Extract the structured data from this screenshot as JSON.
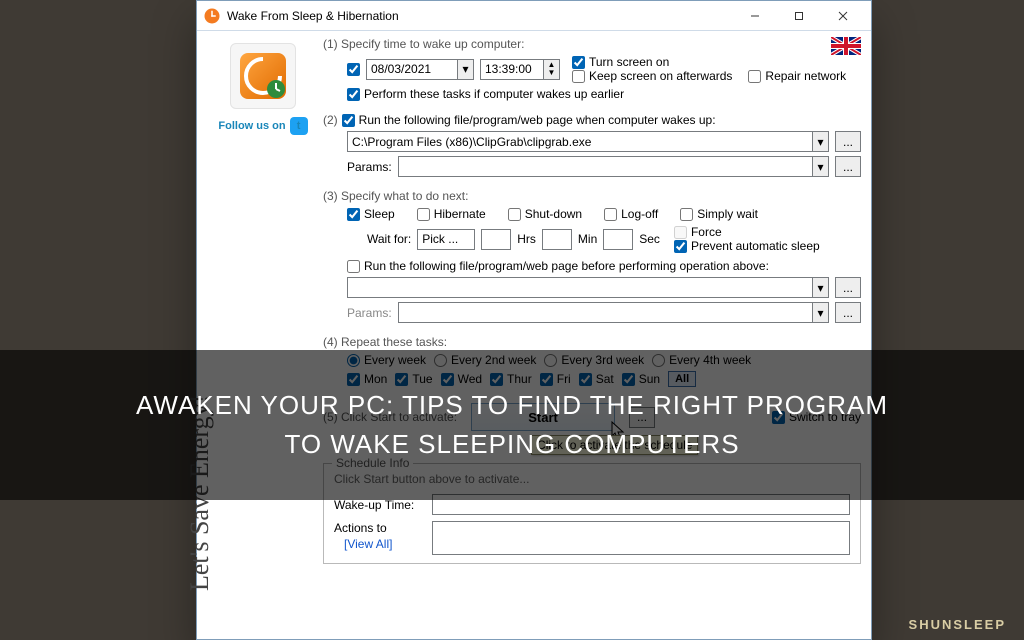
{
  "window": {
    "title": "Wake From Sleep & Hibernation",
    "minimize": "–",
    "maximize": "▢",
    "close": "✕"
  },
  "follow_text": "Follow us on",
  "energy_text": "Let's Save Energy!",
  "s1": {
    "label": "(1) Specify time to wake up computer:",
    "date": "08/03/2021",
    "time": "13:39:00",
    "screen_on": "Turn screen on",
    "keep_screen": "Keep screen on afterwards",
    "repair": "Repair network",
    "perform_earlier": "Perform these tasks if computer wakes up earlier"
  },
  "s2": {
    "label": "Run the following file/program/web page when computer wakes up:",
    "num": "(2)",
    "path": "C:\\Program Files (x86)\\ClipGrab\\clipgrab.exe",
    "params_lbl": "Params:",
    "params": "",
    "browse": "..."
  },
  "s3": {
    "label": "(3) Specify what to do next:",
    "sleep": "Sleep",
    "hibernate": "Hibernate",
    "shutdown": "Shut-down",
    "logoff": "Log-off",
    "simply": "Simply wait",
    "wait_lbl": "Wait for:",
    "pick": "Pick ...",
    "hrs": "Hrs",
    "min": "Min",
    "sec": "Sec",
    "force": "Force",
    "prevent": "Prevent automatic sleep",
    "run_before": "Run the following file/program/web page before performing operation above:",
    "params_lbl": "Params:",
    "browse": "..."
  },
  "s4": {
    "label": "(4) Repeat these tasks:",
    "wk1": "Every week",
    "wk2": "Every 2nd week",
    "wk3": "Every 3rd week",
    "wk4": "Every 4th week",
    "mon": "Mon",
    "tue": "Tue",
    "wed": "Wed",
    "thu": "Thur",
    "fri": "Fri",
    "sat": "Sat",
    "sun": "Sun",
    "all": "All"
  },
  "s5": {
    "label": "(5) Click Start to activate:",
    "start": "Start",
    "dots": "...",
    "switch_tray": "Switch to tray",
    "tooltip": "Click to activate the schedule"
  },
  "sched": {
    "title": "Schedule Info",
    "hint": "Click Start button above to activate...",
    "wake_lbl": "Wake-up Time:",
    "actions_lbl": "Actions to",
    "viewall": "[View All]"
  },
  "overlay": {
    "l1": "AWAKEN YOUR PC: TIPS TO FIND THE RIGHT PROGRAM",
    "l2": "TO WAKE SLEEPING COMPUTERS",
    "brand": "SHUNSLEEP"
  }
}
